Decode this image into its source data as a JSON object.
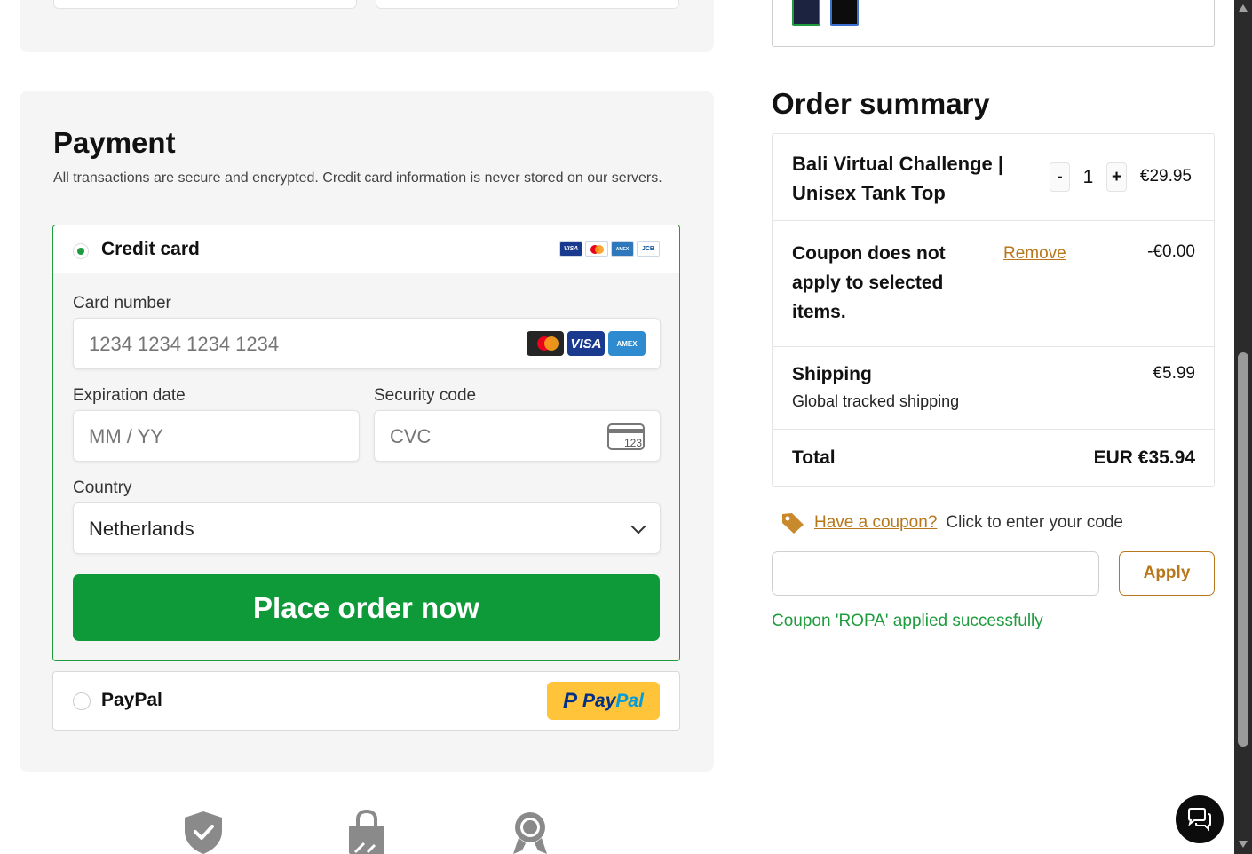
{
  "payment": {
    "title": "Payment",
    "subtitle": "All transactions are secure and encrypted. Credit card information is never stored on our servers.",
    "credit_card": {
      "label": "Credit card",
      "selected": true,
      "mini_brands": [
        "visa-icon",
        "mastercard-icon",
        "amex-icon",
        "jcb-icon"
      ],
      "mini_visa_text": "VISA",
      "mini_amex_text": "AMEX",
      "mini_jcb_text": "JCB",
      "card_number_label": "Card number",
      "card_number_placeholder": "1234 1234 1234 1234",
      "brand_visa_text": "VISA",
      "brand_amex_text": "AMEX",
      "expiration_label": "Expiration date",
      "expiration_placeholder": "MM / YY",
      "security_label": "Security code",
      "security_placeholder": "CVC",
      "cvc_icon_text": "123",
      "country_label": "Country",
      "country_value": "Netherlands",
      "place_order_label": "Place order now"
    },
    "paypal": {
      "label": "PayPal",
      "selected": false,
      "badge_text_1": "Pay",
      "badge_text_2": "Pal",
      "badge_p": "P"
    }
  },
  "order_summary": {
    "title": "Order summary",
    "item": {
      "name": "Bali Virtual Challenge | Unisex Tank Top",
      "quantity": "1",
      "minus": "-",
      "plus": "+",
      "price": "€29.95"
    },
    "coupon_row": {
      "message": "Coupon does not apply to selected items.",
      "remove_label": "Remove",
      "amount": "-€0.00"
    },
    "shipping": {
      "title": "Shipping",
      "method": "Global tracked shipping",
      "price": "€5.99"
    },
    "total": {
      "label": "Total",
      "value": "EUR €35.94"
    }
  },
  "coupon": {
    "link_text": "Have a coupon?",
    "prompt": "Click to enter your code",
    "input_value": "",
    "apply_label": "Apply",
    "success_message": "Coupon 'ROPA' applied successfully"
  },
  "colors": {
    "accent_green": "#0f9a3a",
    "link_gold": "#b7771a",
    "swatches": [
      "#1c2340",
      "#0c0c0c"
    ]
  },
  "icons": {
    "trust": [
      "shield-check-icon",
      "lock-bag-icon",
      "award-ribbon-icon"
    ],
    "chat": "chat-bubble-icon",
    "coupon_tag": "tag-icon"
  }
}
